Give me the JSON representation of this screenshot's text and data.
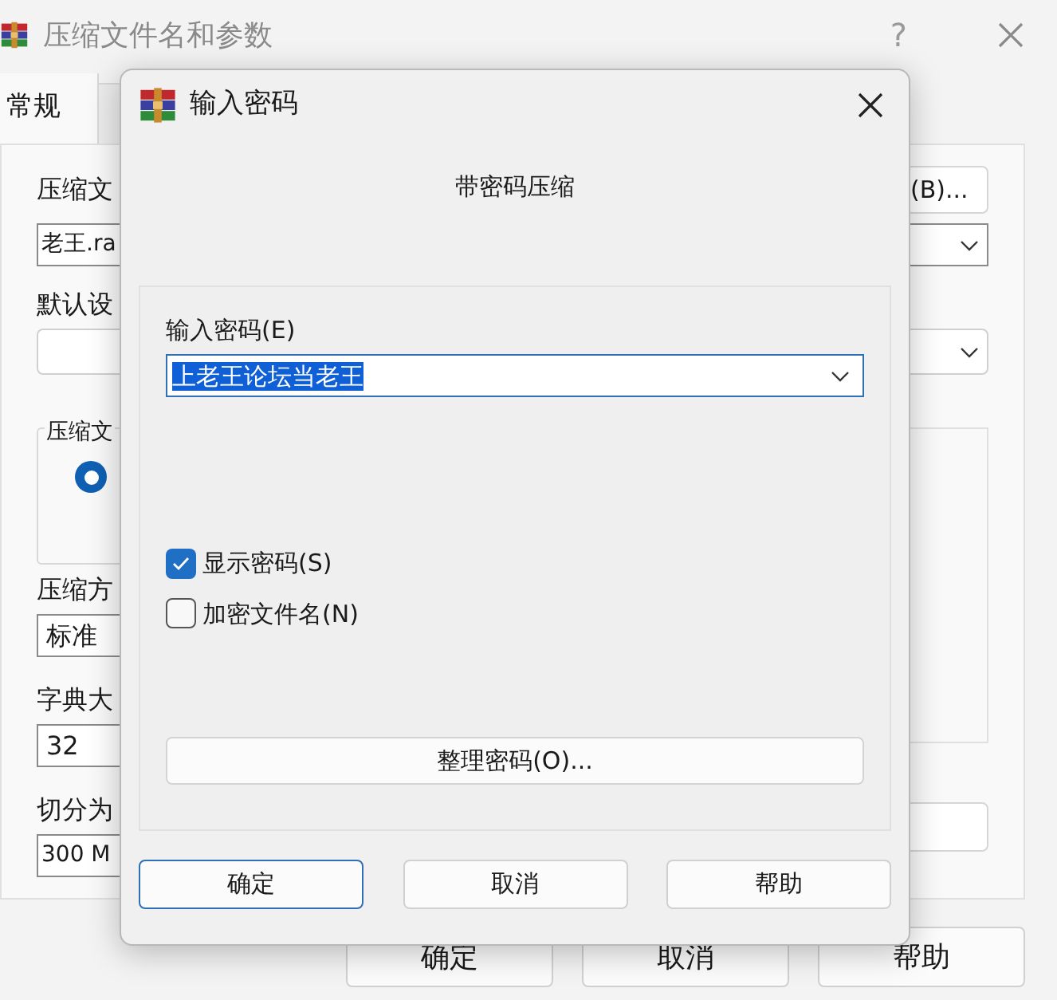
{
  "parent_window": {
    "title": "压缩文件名和参数",
    "help_button": "?",
    "tab": {
      "label": "常规",
      "selected": true
    },
    "browse_button": "(B)...",
    "archive_name": {
      "label": "压缩文",
      "value": "老王.ra"
    },
    "default_settings": {
      "label": "默认设"
    },
    "format_group": {
      "label": "压缩文",
      "radio_selected": true
    },
    "method": {
      "label": "压缩方",
      "value": "标准"
    },
    "dictionary": {
      "label": "字典大",
      "value": "32"
    },
    "split": {
      "label": "切分为",
      "value": "300 M"
    },
    "buttons": [
      "确定",
      "取消",
      "帮助"
    ]
  },
  "dialog": {
    "title": "输入密码",
    "heading": "带密码压缩",
    "password": {
      "label": "输入密码(E)",
      "value": "上老王论坛当老王",
      "selected": true
    },
    "options": [
      {
        "label": "显示密码(S)",
        "checked": true
      },
      {
        "label": "加密文件名(N)",
        "checked": false
      }
    ],
    "organize_button": "整理密码(O)...",
    "buttons": [
      {
        "label": "确定",
        "default": true
      },
      {
        "label": "取消",
        "default": false
      },
      {
        "label": "帮助",
        "default": false
      }
    ]
  }
}
